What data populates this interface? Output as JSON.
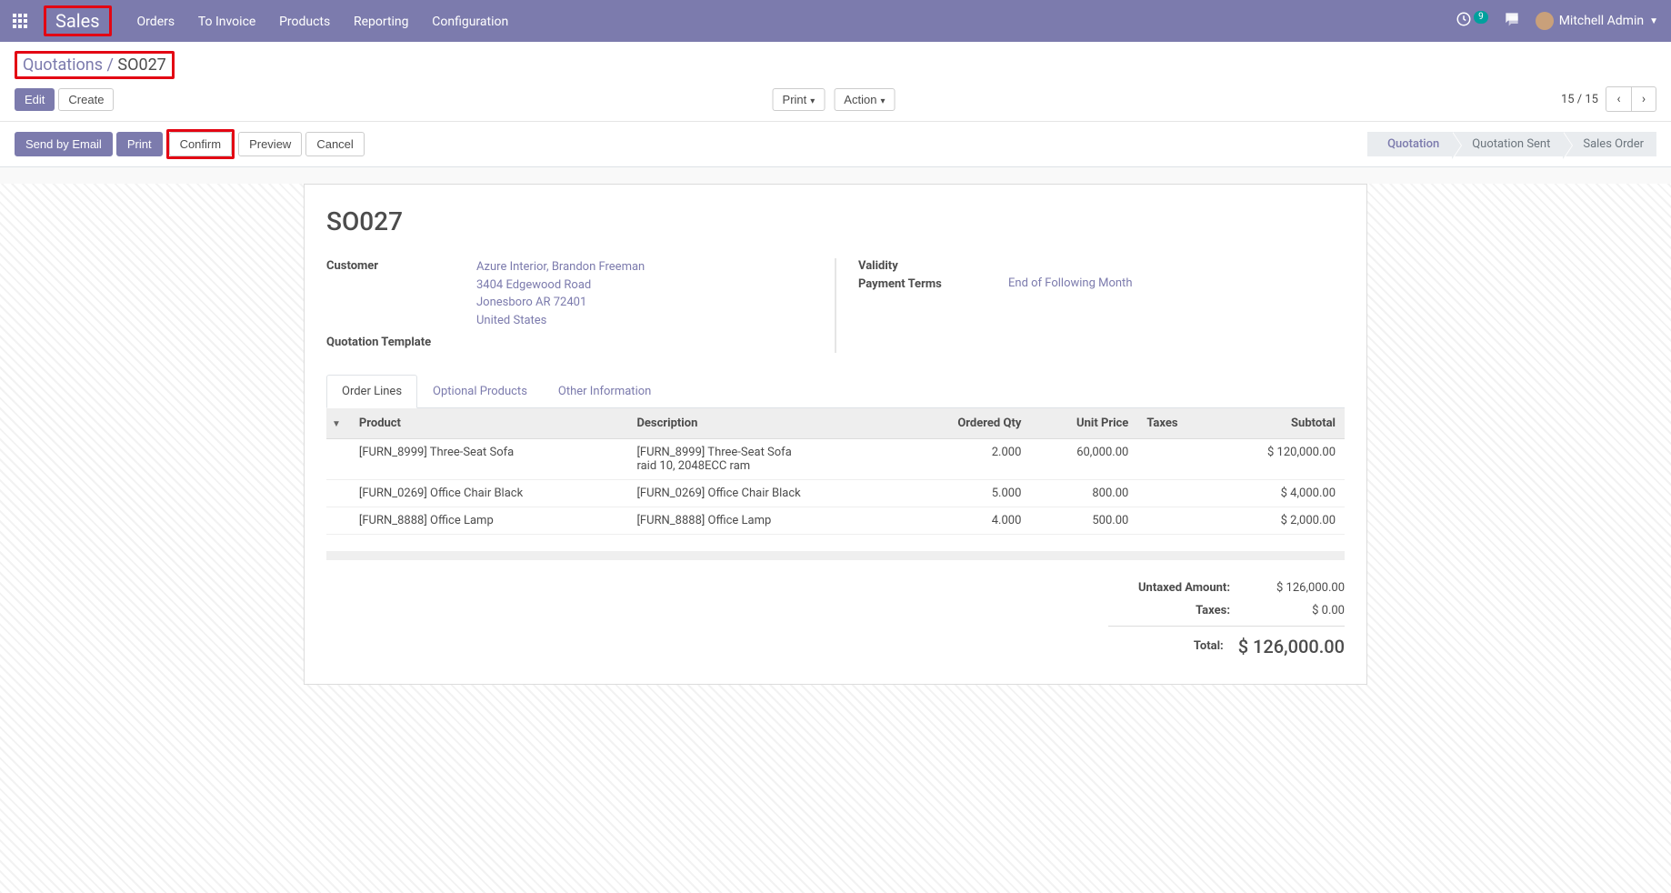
{
  "topnav": {
    "brand": "Sales",
    "menu": [
      "Orders",
      "To Invoice",
      "Products",
      "Reporting",
      "Configuration"
    ],
    "notif_count": "9",
    "user": "Mitchell Admin"
  },
  "breadcrumb": {
    "parent": "Quotations",
    "sep": " / ",
    "current": "SO027"
  },
  "toolbar": {
    "edit": "Edit",
    "create": "Create",
    "print": "Print",
    "action": "Action",
    "pager": "15 / 15"
  },
  "actions": {
    "send_email": "Send by Email",
    "print": "Print",
    "confirm": "Confirm",
    "preview": "Preview",
    "cancel": "Cancel"
  },
  "status": {
    "s1": "Quotation",
    "s2": "Quotation Sent",
    "s3": "Sales Order"
  },
  "record": {
    "name": "SO027",
    "customer_label": "Customer",
    "customer_name": "Azure Interior, Brandon Freeman",
    "customer_addr1": "3404 Edgewood Road",
    "customer_addr2": "Jonesboro AR 72401",
    "customer_addr3": "United States",
    "template_label": "Quotation Template",
    "validity_label": "Validity",
    "payment_terms_label": "Payment Terms",
    "payment_terms": "End of Following Month"
  },
  "tabs": {
    "t1": "Order Lines",
    "t2": "Optional Products",
    "t3": "Other Information"
  },
  "columns": {
    "product": "Product",
    "description": "Description",
    "qty": "Ordered Qty",
    "unit_price": "Unit Price",
    "taxes": "Taxes",
    "subtotal": "Subtotal"
  },
  "lines": [
    {
      "product": "[FURN_8999] Three-Seat Sofa",
      "desc1": "[FURN_8999] Three-Seat Sofa",
      "desc2": "raid 10, 2048ECC ram",
      "qty": "2.000",
      "price": "60,000.00",
      "taxes": "",
      "subtotal": "$ 120,000.00"
    },
    {
      "product": "[FURN_0269] Office Chair Black",
      "desc1": "[FURN_0269] Office Chair Black",
      "desc2": "",
      "qty": "5.000",
      "price": "800.00",
      "taxes": "",
      "subtotal": "$ 4,000.00"
    },
    {
      "product": "[FURN_8888] Office Lamp",
      "desc1": "[FURN_8888] Office Lamp",
      "desc2": "",
      "qty": "4.000",
      "price": "500.00",
      "taxes": "",
      "subtotal": "$ 2,000.00"
    }
  ],
  "totals": {
    "untaxed_label": "Untaxed Amount:",
    "untaxed": "$ 126,000.00",
    "taxes_label": "Taxes:",
    "taxes": "$ 0.00",
    "total_label": "Total:",
    "total": "$ 126,000.00"
  }
}
